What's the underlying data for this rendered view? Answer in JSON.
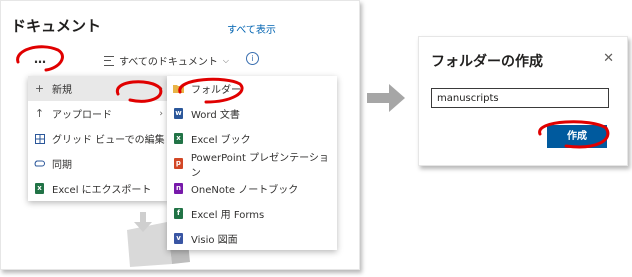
{
  "left_panel": {
    "title": "ドキュメント",
    "show_all": "すべて表示",
    "more_label": "…",
    "view_switch_label": "すべてのドキュメント",
    "new_menu": [
      {
        "label": "新規",
        "icon": "plus-icon"
      },
      {
        "label": "アップロード",
        "icon": "upload-icon"
      },
      {
        "label": "グリッド ビューでの編集",
        "icon": "grid-icon"
      },
      {
        "label": "同期",
        "icon": "sync-icon"
      },
      {
        "label": "Excel にエクスポート",
        "icon": "excel-icon"
      }
    ],
    "submenu": [
      {
        "label": "フォルダー",
        "icon": "folder-icon",
        "color": "#e8b548"
      },
      {
        "label": "Word 文書",
        "icon": "word-icon",
        "color": "#2b579a"
      },
      {
        "label": "Excel ブック",
        "icon": "excel-icon",
        "color": "#217346"
      },
      {
        "label": "PowerPoint プレゼンテーション",
        "icon": "powerpoint-icon",
        "color": "#d24726"
      },
      {
        "label": "OneNote ノートブック",
        "icon": "onenote-icon",
        "color": "#7719aa"
      },
      {
        "label": "Excel 用 Forms",
        "icon": "forms-icon",
        "color": "#217346"
      },
      {
        "label": "Visio 図面",
        "icon": "visio-icon",
        "color": "#3955a3"
      }
    ]
  },
  "dialog": {
    "title": "フォルダーの作成",
    "input_value": "manuscripts",
    "create_label": "作成"
  },
  "colors": {
    "accent": "#005a9e",
    "link": "#0063b1",
    "annotation": "#e00000"
  }
}
